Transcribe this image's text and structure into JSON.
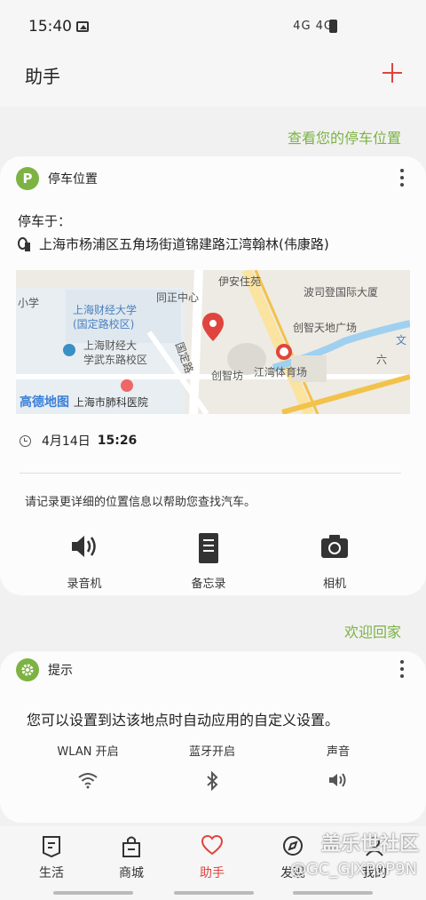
{
  "status": {
    "time": "15:40",
    "signal": "4G 4G"
  },
  "header": {
    "title": "助手"
  },
  "parking": {
    "link": "查看您的停车位置",
    "card_title": "停车位置",
    "badge": "P",
    "parked_at": "停车于：",
    "address": "上海市杨浦区五角场街道锦建路江湾翰林(伟康路)",
    "date": "4月14日",
    "time": "15:26",
    "hint": "请记录更详细的位置信息以帮助您查找汽车。",
    "actions": [
      {
        "label": "录音机",
        "icon": "speaker-icon"
      },
      {
        "label": "备忘录",
        "icon": "memo-icon"
      },
      {
        "label": "相机",
        "icon": "camera-icon"
      }
    ],
    "map": {
      "logo": "高德地图",
      "labels": [
        "上海财经大学",
        "(国定路校区)",
        "上海财经大",
        "学武东路校区",
        "国定路",
        "同正中心",
        "伊安住苑",
        "波司登国际大厦",
        "创智天地广场",
        "创智坊",
        "江湾体育场",
        "上海市肺科医院",
        "小学",
        "六",
        "文"
      ]
    }
  },
  "tips": {
    "link": "欢迎回家",
    "card_title": "提示",
    "text": "您可以设置到达该地点时自动应用的自定义设置。",
    "settings": [
      {
        "label": "WLAN 开启",
        "icon": "wifi-icon"
      },
      {
        "label": "蓝牙开启",
        "icon": "bluetooth-icon"
      },
      {
        "label": "声音",
        "icon": "volume-icon"
      }
    ]
  },
  "nav": [
    {
      "label": "生活",
      "icon": "life-icon"
    },
    {
      "label": "商城",
      "icon": "shop-icon"
    },
    {
      "label": "助手",
      "icon": "heart-icon"
    },
    {
      "label": "发现",
      "icon": "compass-icon"
    },
    {
      "label": "我的",
      "icon": "user-icon"
    }
  ],
  "watermark": {
    "line1": "盖乐世社区",
    "line2": "@GC_GJXP0P9N"
  },
  "colors": {
    "accent_green": "#7cb342",
    "accent_red": "#e0443e"
  }
}
